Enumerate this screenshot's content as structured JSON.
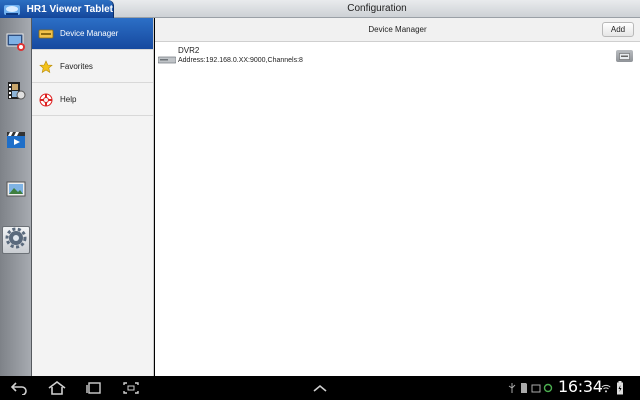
{
  "app": {
    "title": "HR1 Viewer Tablet",
    "logo_icon": "app-logo-icon"
  },
  "page": {
    "title": "Configuration"
  },
  "rail": {
    "items": [
      {
        "icon": "live-view-icon"
      },
      {
        "icon": "playback-icon"
      },
      {
        "icon": "video-clip-icon"
      },
      {
        "icon": "image-gallery-icon"
      },
      {
        "icon": "settings-gear-icon",
        "selected": true
      }
    ]
  },
  "menu": {
    "items": [
      {
        "label": "Device Manager",
        "icon": "dvr-device-icon",
        "selected": true
      },
      {
        "label": "Favorites",
        "icon": "star-icon"
      },
      {
        "label": "Help",
        "icon": "lifebuoy-icon"
      }
    ]
  },
  "main": {
    "header_title": "Device Manager",
    "add_label": "Add",
    "devices": [
      {
        "name": "DVR2",
        "address": "Address:192.168.0.XX:9000,Channels:8"
      }
    ]
  },
  "system_bar": {
    "time": "16:34"
  },
  "colors": {
    "accent": "#1c57ad",
    "menu_background": "#f3f3f3"
  }
}
